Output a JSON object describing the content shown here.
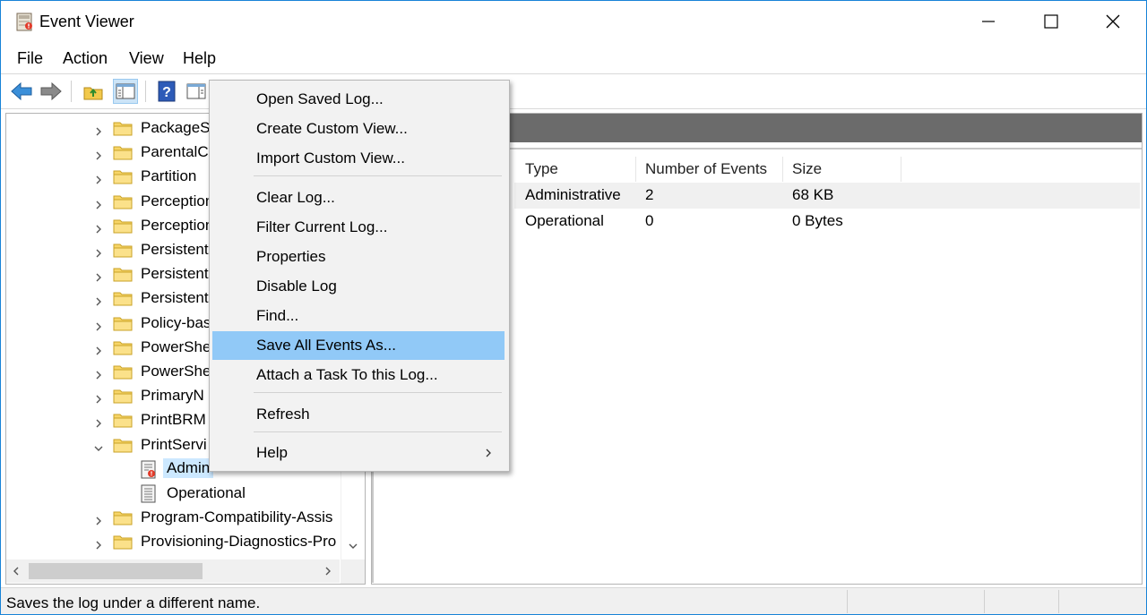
{
  "window": {
    "title": "Event Viewer",
    "icon": "event-viewer-icon",
    "controls": [
      "minimize-icon",
      "maximize-icon",
      "close-icon"
    ]
  },
  "menubar": {
    "items": [
      {
        "label": "File"
      },
      {
        "label": "Action"
      },
      {
        "label": "View"
      },
      {
        "label": "Help"
      }
    ]
  },
  "toolbar": {
    "buttons": [
      "back-arrow-icon",
      "forward-arrow-icon",
      "up-folder-icon",
      "show-hide-console-tree-icon",
      "help-icon",
      "show-hide-action-pane-icon"
    ]
  },
  "tree": {
    "items": [
      {
        "label": "PackageSt",
        "expanded": false,
        "type": "folder"
      },
      {
        "label": "ParentalC",
        "expanded": false,
        "type": "folder"
      },
      {
        "label": "Partition",
        "expanded": false,
        "type": "folder"
      },
      {
        "label": "Perception",
        "expanded": false,
        "type": "folder"
      },
      {
        "label": "Perception",
        "expanded": false,
        "type": "folder"
      },
      {
        "label": "Persistent",
        "expanded": false,
        "type": "folder"
      },
      {
        "label": "Persistent",
        "expanded": false,
        "type": "folder"
      },
      {
        "label": "Persistent",
        "expanded": false,
        "type": "folder"
      },
      {
        "label": "Policy-bas",
        "expanded": false,
        "type": "folder"
      },
      {
        "label": "PowerShe",
        "expanded": false,
        "type": "folder"
      },
      {
        "label": "PowerShe",
        "expanded": false,
        "type": "folder"
      },
      {
        "label": "PrimaryN",
        "expanded": false,
        "type": "folder"
      },
      {
        "label": "PrintBRM",
        "expanded": false,
        "type": "folder"
      },
      {
        "label": "PrintServi",
        "expanded": true,
        "type": "folder"
      },
      {
        "label": "Admin",
        "type": "log",
        "selected": true
      },
      {
        "label": "Operational",
        "type": "log"
      },
      {
        "label": "Program-Compatibility-Assis",
        "expanded": false,
        "type": "folder"
      },
      {
        "label": "Provisioning-Diagnostics-Pro",
        "expanded": false,
        "type": "folder"
      }
    ]
  },
  "list": {
    "columns": [
      "Type",
      "Number of Events",
      "Size"
    ],
    "rows": [
      {
        "type": "Administrative",
        "events": "2",
        "size": "68 KB",
        "selected": true
      },
      {
        "type": "Operational",
        "events": "0",
        "size": "0 Bytes",
        "selected": false
      }
    ]
  },
  "context_menu": {
    "items": [
      {
        "label": "Open Saved Log..."
      },
      {
        "label": "Create Custom View..."
      },
      {
        "label": "Import Custom View..."
      },
      {
        "label": "Clear Log..."
      },
      {
        "label": "Filter Current Log..."
      },
      {
        "label": "Properties"
      },
      {
        "label": "Disable Log"
      },
      {
        "label": "Find..."
      },
      {
        "label": "Save All Events As...",
        "highlighted": true
      },
      {
        "label": "Attach a Task To this Log..."
      },
      {
        "label": "Refresh"
      },
      {
        "label": "Help",
        "submenu": true
      }
    ]
  },
  "statusbar": {
    "text": "Saves the log under a different name."
  },
  "colors": {
    "highlight": "#91c9f7",
    "selection": "#cce8ff",
    "window_border": "#1883d7",
    "pane_header": "#6b6b6b"
  }
}
